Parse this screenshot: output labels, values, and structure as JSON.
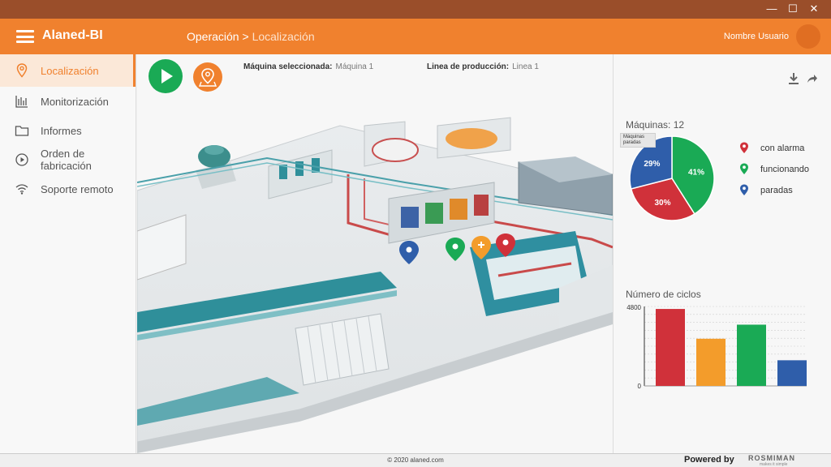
{
  "window": {
    "minimize": "—",
    "maximize": "☐",
    "close": "✕"
  },
  "app": {
    "title": "Alaned-BI"
  },
  "breadcrumb": {
    "root": "Operación",
    "separator": " > ",
    "current": "Localización"
  },
  "user": {
    "name": "Nombre Usuario"
  },
  "sidebar": {
    "items": [
      {
        "label": "Localización",
        "icon": "location-pin-icon"
      },
      {
        "label": "Monitorización",
        "icon": "bar-chart-icon"
      },
      {
        "label": "Informes",
        "icon": "folder-icon"
      },
      {
        "label": "Orden de fabricación",
        "icon": "play-circle-icon"
      },
      {
        "label": "Soporte remoto",
        "icon": "wifi-icon"
      }
    ]
  },
  "info": {
    "machine_label": "Máquina seleccionada:",
    "machine_value": "Máquina 1",
    "line_label": "Linea de producción:",
    "line_value": "Linea 1"
  },
  "colors": {
    "accent": "#f0812e",
    "alarm": "#d0313a",
    "running": "#1aaa55",
    "stopped": "#2f5eaa",
    "amber": "#f39c2b"
  },
  "machines": {
    "title": "Máquinas: 12",
    "tooltip": "Máquinas paradas"
  },
  "legend": [
    {
      "label": "con alarma",
      "color": "#d0313a"
    },
    {
      "label": "funcionando",
      "color": "#1aaa55"
    },
    {
      "label": "paradas",
      "color": "#2f5eaa"
    }
  ],
  "cycles": {
    "title": "Número de ciclos"
  },
  "chart_data": [
    {
      "type": "pie",
      "title": "Máquinas: 12",
      "slices": [
        {
          "label": "funcionando",
          "value": 41,
          "color": "#1aaa55"
        },
        {
          "label": "con alarma",
          "value": 30,
          "color": "#d0313a"
        },
        {
          "label": "paradas",
          "value": 29,
          "color": "#2f5eaa"
        }
      ]
    },
    {
      "type": "bar",
      "title": "Número de ciclos",
      "yticks": [
        "4800",
        "0"
      ],
      "ylim": [
        0,
        4800
      ],
      "values": [
        4650,
        2850,
        3700,
        1550
      ],
      "colors": [
        "#d0313a",
        "#f39c2b",
        "#1aaa55",
        "#2f5eaa"
      ]
    }
  ],
  "footer": {
    "copyright": "© 2020 alaned.com",
    "powered": "Powered by",
    "brand": "ROSMIMAN",
    "brand_tagline": "makes it simple"
  }
}
